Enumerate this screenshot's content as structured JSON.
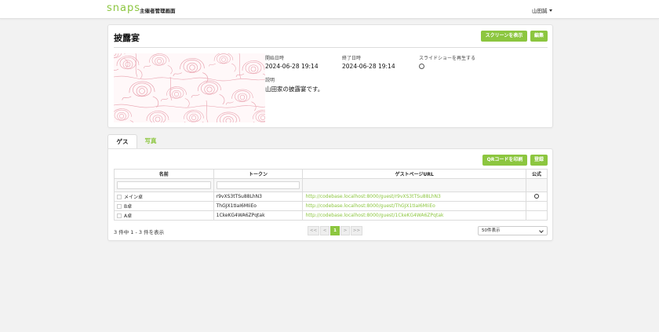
{
  "header": {
    "logo": "snaps",
    "app_title": "主催者管理画面",
    "user_name": "山田誠"
  },
  "event": {
    "title": "披露宴",
    "screen_button": "スクリーンを表示",
    "edit_button": "編集",
    "start_label": "開始日時",
    "start_value": "2024-06-28 19:14",
    "end_label": "終了日時",
    "end_value": "2024-06-28 19:14",
    "slideshow_label": "スライドショーを再生する",
    "description_label": "説明",
    "description_value": "山田家の披露宴です。"
  },
  "tabs": [
    {
      "label": "ゲスト",
      "active": true
    },
    {
      "label": "写真",
      "active": false
    }
  ],
  "guests": {
    "qr_button": "QRコードを印刷",
    "register_button": "登録",
    "columns": [
      "名前",
      "トークン",
      "ゲストページURL",
      "公式"
    ],
    "rows": [
      {
        "name": "メイン卓",
        "token": "r9vXS3tTSu88LhN3",
        "url": "http://codebase.localhost:8000/guest/r9vXS3tTSu88LhN3",
        "official": true
      },
      {
        "name": "B卓",
        "token": "ThGJX1tIaI6MIiEo",
        "url": "http://codebase.localhost:8000/guest/ThGJX1tIaI6MIiEo",
        "official": false
      },
      {
        "name": "A卓",
        "token": "1CkeKG4WA6ZPqtak",
        "url": "http://codebase.localhost:8000/guest/1CkeKG4WA6ZPqtak",
        "official": false
      }
    ],
    "count_text": "3 件中 1 - 3 件を表示",
    "pager": {
      "first": "<<",
      "prev": "<",
      "current": "1",
      "next": ">",
      "last": ">>"
    },
    "page_size": "50件表示"
  },
  "colors": {
    "accent": "#8cc63f",
    "floral": "#e8a0ad"
  }
}
